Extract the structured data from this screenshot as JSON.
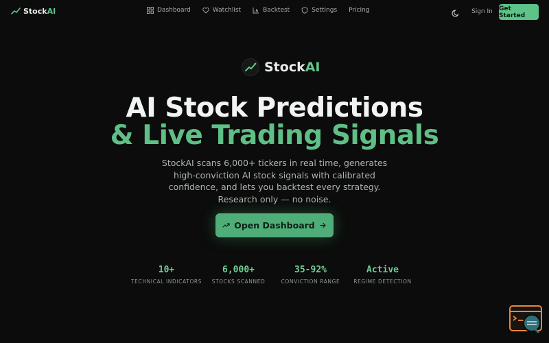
{
  "brand": {
    "name_prefix": "Stock",
    "name_suffix": "AI"
  },
  "nav": {
    "links": [
      {
        "label": "Dashboard",
        "icon": "grid-icon"
      },
      {
        "label": "Watchlist",
        "icon": "heart-icon"
      },
      {
        "label": "Backtest",
        "icon": "bar-chart-icon"
      },
      {
        "label": "Settings",
        "icon": "shield-icon"
      },
      {
        "label": "Pricing",
        "icon": ""
      }
    ],
    "theme_icon": "moon-icon",
    "sign_in": "Sign In",
    "get_started": "Get Started"
  },
  "hero": {
    "logo_prefix": "Stock",
    "logo_suffix": "AI",
    "headline_line1": "AI Stock Predictions",
    "headline_line2": "& Live Trading Signals",
    "subtitle": "StockAI scans 6,000+ tickers in real time, generates high-conviction AI stock signals with calibrated confidence, and lets you backtest every strategy. Research only — no noise.",
    "cta_label": "Open Dashboard",
    "cta_icons": [
      "trending-up-icon",
      "arrow-right-icon"
    ]
  },
  "stats": [
    {
      "value": "10+",
      "label": "TECHNICAL INDICATORS"
    },
    {
      "value": "6,000+",
      "label": "STOCKS SCANNED"
    },
    {
      "value": "35-92%",
      "label": "CONVICTION RANGE"
    },
    {
      "value": "Active",
      "label": "REGIME DETECTION"
    }
  ],
  "colors": {
    "background": "#0b0c0b",
    "accent": "#5fc88a",
    "cta": "#4fae78",
    "chat_widget": "#e8873a"
  }
}
